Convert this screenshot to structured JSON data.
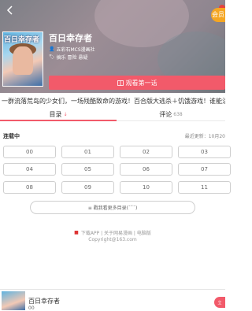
{
  "header": {
    "back_icon": "chevron-left-icon",
    "vip_label": "会员"
  },
  "comic": {
    "cover_title": "百日幸存者",
    "title": "百日幸存者",
    "author": "五彩石MCS漫画社",
    "tags": "搞乐 冒险 悬疑",
    "read_button": "观看第一话",
    "description": "一群流落荒岛的少女们，一场残酷致命的游戏！百合版大逃杀＋饥饿游戏！谁能活到最后！"
  },
  "tabs": {
    "chapters_label": "目录",
    "chapters_sort": "↓",
    "comments_label": "评论",
    "comments_count": "638"
  },
  "chapters": {
    "status": "连载中",
    "updated": "最近更新：10月20",
    "episodes": [
      "00",
      "01",
      "02",
      "03",
      "04",
      "05",
      "06",
      "07",
      "08",
      "09",
      "10",
      "11"
    ],
    "expand_label": "≡ 戳我看更多目录(¯ˇ¯)"
  },
  "footer": {
    "links": "下载APP | 关于网易漫画 | 电脑版",
    "copyright": "Copyright@163.com"
  },
  "bottom_bar": {
    "title": "百日幸存者",
    "subtitle": "00",
    "button": "立"
  },
  "colors": {
    "accent": "#f25a6a",
    "vip": "#f5a623"
  }
}
